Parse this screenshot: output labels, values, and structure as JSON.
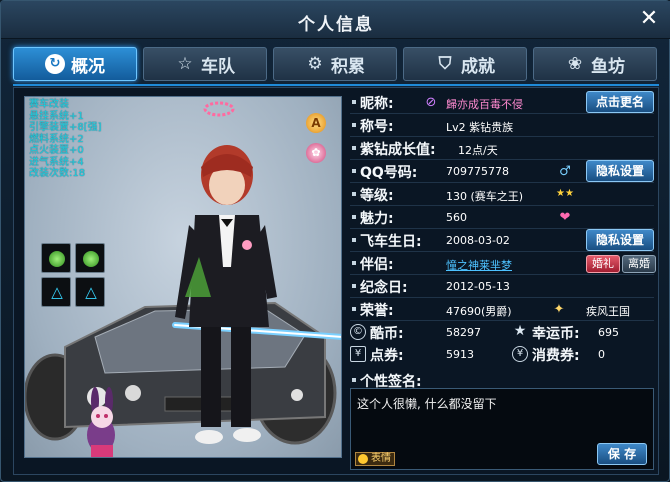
{
  "window": {
    "title": "个人信息",
    "close_label": "✕"
  },
  "tabs": [
    {
      "label": "概况",
      "icon": "refresh-icon",
      "glyph": "↻",
      "active": true
    },
    {
      "label": "车队",
      "icon": "star-icon",
      "glyph": "☆",
      "active": false
    },
    {
      "label": "积累",
      "icon": "gear-icon",
      "glyph": "⚙",
      "active": false
    },
    {
      "label": "成就",
      "icon": "achievement-icon",
      "glyph": "⛉",
      "active": false
    },
    {
      "label": "鱼坊",
      "icon": "fish-icon",
      "glyph": "❀",
      "active": false
    }
  ],
  "mods": [
    "赛车改装",
    "悬挂系统+1",
    "引擎装置+8[强]",
    "燃料系统+2",
    "点火装置+0",
    "进气系统+4",
    "改装次数:18"
  ],
  "profile": {
    "nickname_label": "昵称:",
    "nickname": "歸亦成百毒不侵",
    "rename_button": "点击更名",
    "title_label": "称号:",
    "title_value": "Lv2 紫钻贵族",
    "growth_label": "紫钻成长值:",
    "growth_value": "12点/天",
    "qq_label": "QQ号码:",
    "qq_value": "709775778",
    "privacy_button_1": "隐私设置",
    "level_label": "等级:",
    "level_value": "130 (赛车之王)",
    "charm_label": "魅力:",
    "charm_value": "560",
    "birthday_label": "飞车生日:",
    "birthday_value": "2008-03-02",
    "privacy_button_2": "隐私设置",
    "partner_label": "伴侣:",
    "partner_value": "憧之神莱芈梦",
    "gift_button": "婚礼",
    "divorce_button": "离婚",
    "anniversary_label": "纪念日:",
    "anniversary_value": "2012-05-13",
    "honor_label": "荣誉:",
    "honor_value": "47690(男爵)",
    "kingdom_value": "疾风王国"
  },
  "currency": {
    "coolcoin_label": "酷币:",
    "coolcoin_value": "58297",
    "lucky_label": "幸运币:",
    "lucky_value": "695",
    "voucher_label": "点券:",
    "voucher_value": "5913",
    "consume_label": "消费券:",
    "consume_value": "0"
  },
  "signature": {
    "label": "个性签名:",
    "text": "这个人很懒, 什么都没留下",
    "emoji_button": "表情",
    "save_button": "保 存"
  },
  "colors": {
    "accent": "#1f8ad8",
    "mod_text": "#1fd0e0",
    "partner_link": "#4dc2ff"
  }
}
